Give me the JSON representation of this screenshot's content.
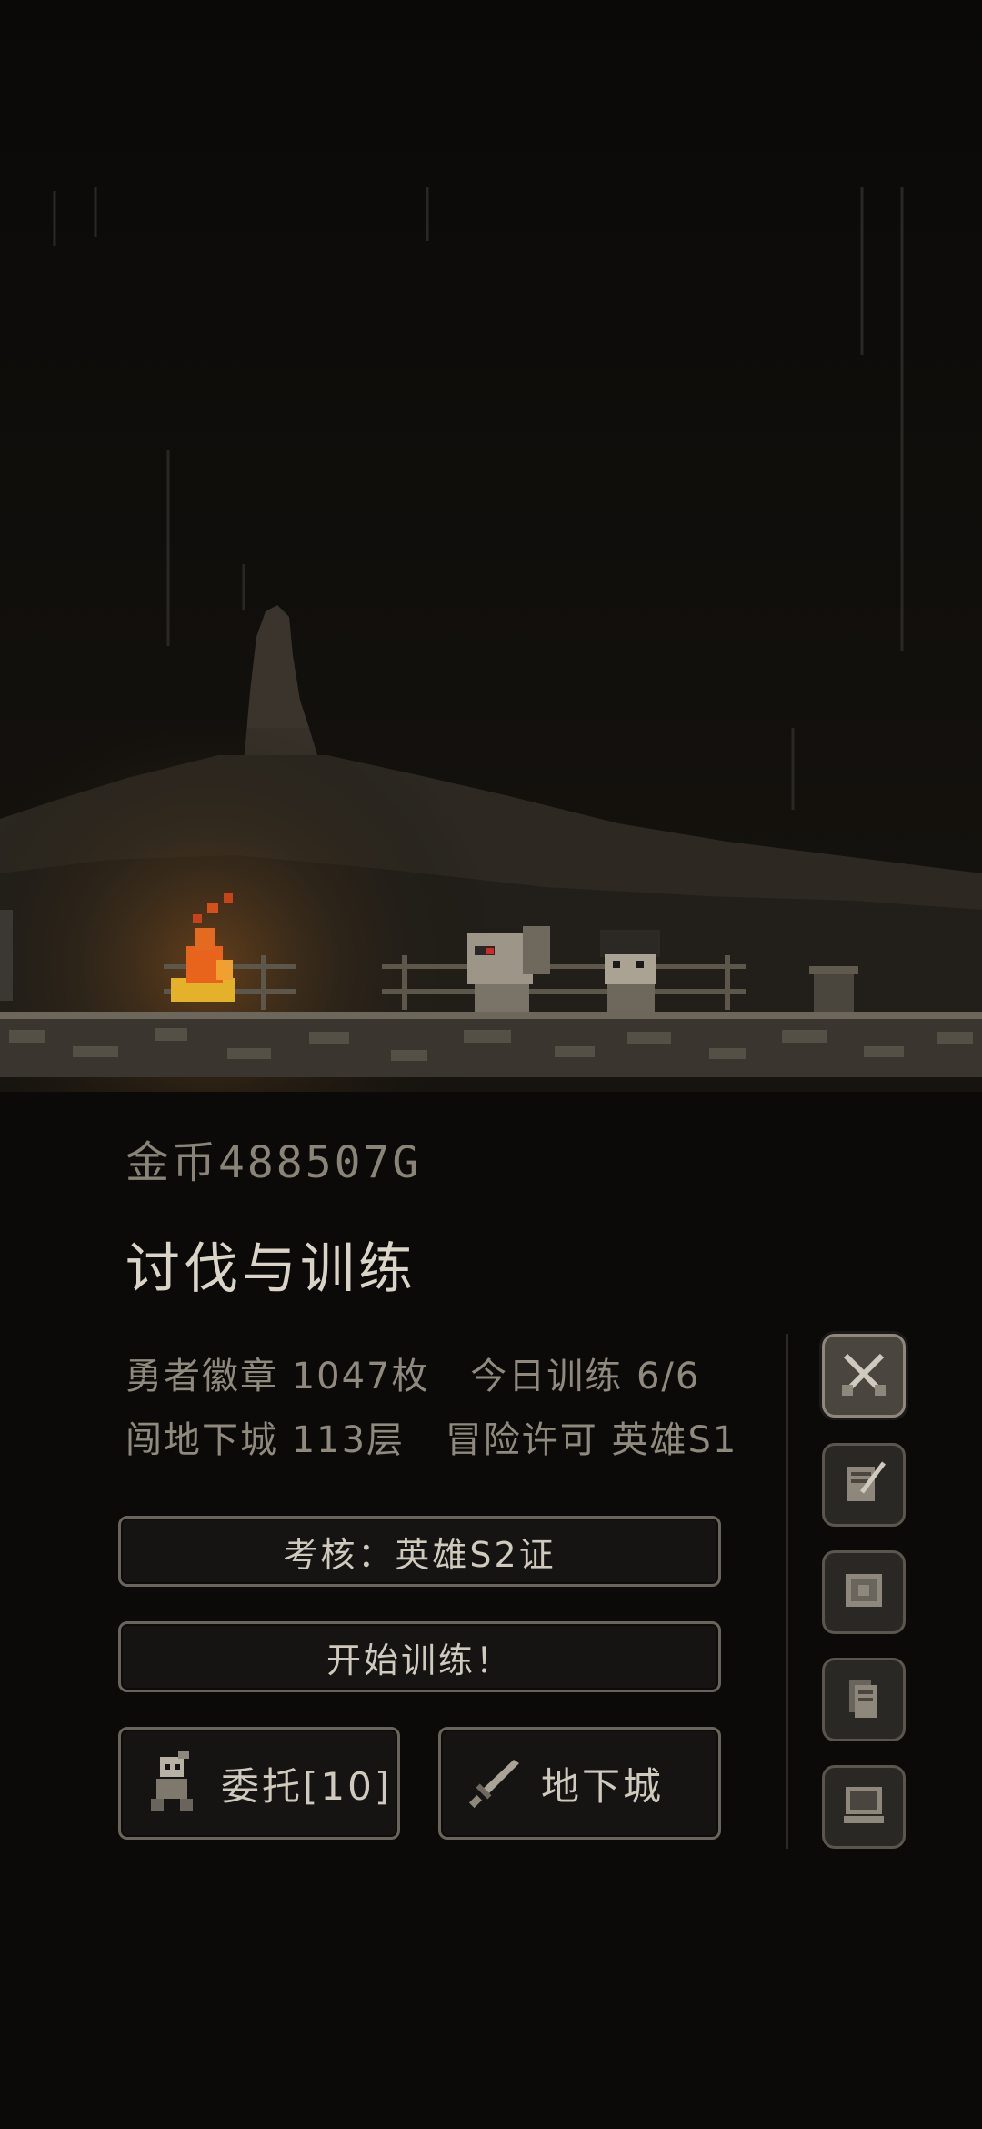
{
  "header": {
    "gold_label": "金币488507G",
    "title": "讨伐与训练"
  },
  "stats": {
    "badge": "勇者徽章 1047枚",
    "today_training": "今日训练 6/6",
    "dungeon_floor": "闯地下城 113层",
    "license": "冒险许可 英雄S1"
  },
  "buttons": {
    "exam": "考核：英雄S2证",
    "train": "开始训练！",
    "quest": "委托[10]",
    "dungeon": "地下城"
  },
  "icons": {
    "quest": "skull-knight-icon",
    "dungeon": "sword-icon",
    "side": [
      "crossed-swords-icon",
      "scroll-quill-icon",
      "map-icon",
      "document-stack-icon",
      "computer-icon"
    ]
  },
  "colors": {
    "background": "#0b0a09",
    "fire": "#e8641c",
    "text": "#cfc9be"
  }
}
